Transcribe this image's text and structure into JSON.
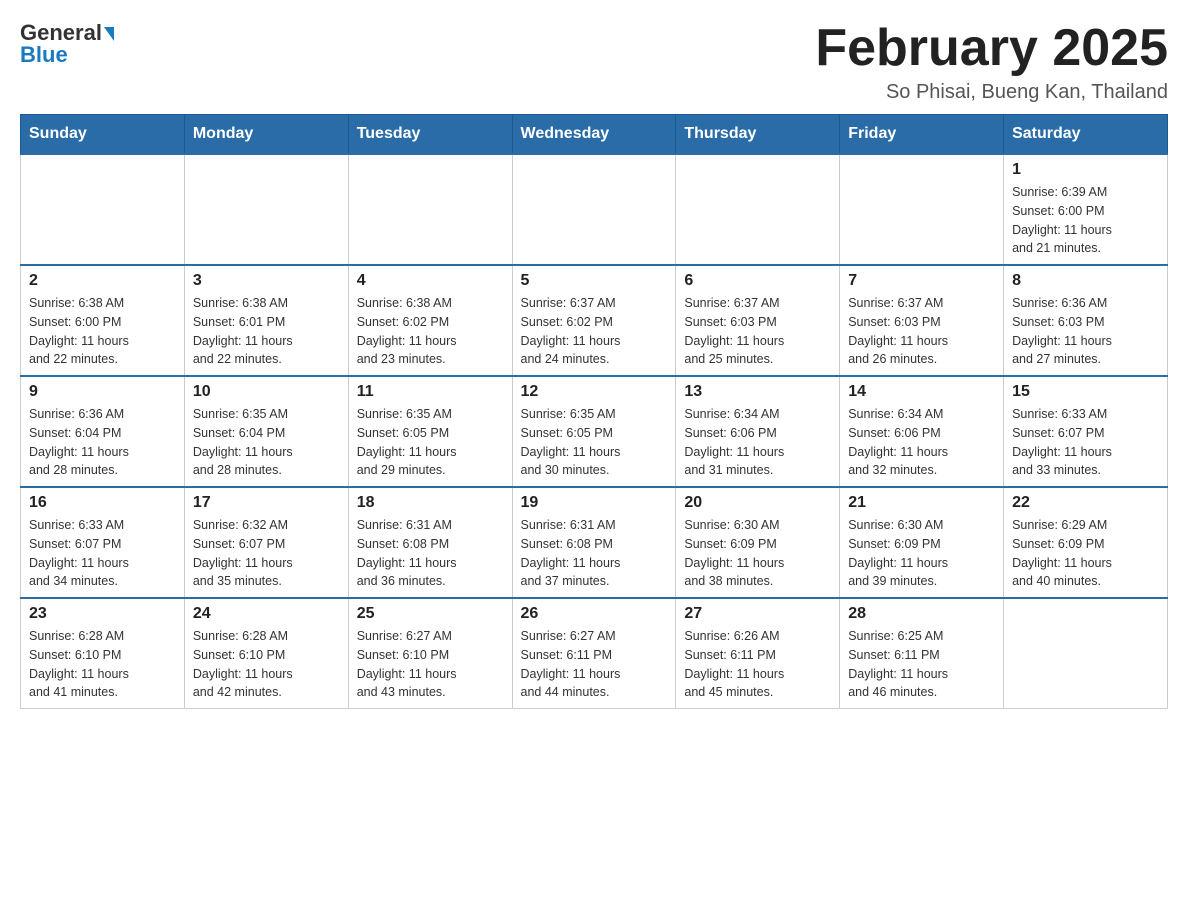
{
  "header": {
    "logo_general": "General",
    "logo_blue": "Blue",
    "month_title": "February 2025",
    "subtitle": "So Phisai, Bueng Kan, Thailand"
  },
  "weekdays": [
    "Sunday",
    "Monday",
    "Tuesday",
    "Wednesday",
    "Thursday",
    "Friday",
    "Saturday"
  ],
  "weeks": [
    [
      {
        "day": "",
        "info": ""
      },
      {
        "day": "",
        "info": ""
      },
      {
        "day": "",
        "info": ""
      },
      {
        "day": "",
        "info": ""
      },
      {
        "day": "",
        "info": ""
      },
      {
        "day": "",
        "info": ""
      },
      {
        "day": "1",
        "info": "Sunrise: 6:39 AM\nSunset: 6:00 PM\nDaylight: 11 hours\nand 21 minutes."
      }
    ],
    [
      {
        "day": "2",
        "info": "Sunrise: 6:38 AM\nSunset: 6:00 PM\nDaylight: 11 hours\nand 22 minutes."
      },
      {
        "day": "3",
        "info": "Sunrise: 6:38 AM\nSunset: 6:01 PM\nDaylight: 11 hours\nand 22 minutes."
      },
      {
        "day": "4",
        "info": "Sunrise: 6:38 AM\nSunset: 6:02 PM\nDaylight: 11 hours\nand 23 minutes."
      },
      {
        "day": "5",
        "info": "Sunrise: 6:37 AM\nSunset: 6:02 PM\nDaylight: 11 hours\nand 24 minutes."
      },
      {
        "day": "6",
        "info": "Sunrise: 6:37 AM\nSunset: 6:03 PM\nDaylight: 11 hours\nand 25 minutes."
      },
      {
        "day": "7",
        "info": "Sunrise: 6:37 AM\nSunset: 6:03 PM\nDaylight: 11 hours\nand 26 minutes."
      },
      {
        "day": "8",
        "info": "Sunrise: 6:36 AM\nSunset: 6:03 PM\nDaylight: 11 hours\nand 27 minutes."
      }
    ],
    [
      {
        "day": "9",
        "info": "Sunrise: 6:36 AM\nSunset: 6:04 PM\nDaylight: 11 hours\nand 28 minutes."
      },
      {
        "day": "10",
        "info": "Sunrise: 6:35 AM\nSunset: 6:04 PM\nDaylight: 11 hours\nand 28 minutes."
      },
      {
        "day": "11",
        "info": "Sunrise: 6:35 AM\nSunset: 6:05 PM\nDaylight: 11 hours\nand 29 minutes."
      },
      {
        "day": "12",
        "info": "Sunrise: 6:35 AM\nSunset: 6:05 PM\nDaylight: 11 hours\nand 30 minutes."
      },
      {
        "day": "13",
        "info": "Sunrise: 6:34 AM\nSunset: 6:06 PM\nDaylight: 11 hours\nand 31 minutes."
      },
      {
        "day": "14",
        "info": "Sunrise: 6:34 AM\nSunset: 6:06 PM\nDaylight: 11 hours\nand 32 minutes."
      },
      {
        "day": "15",
        "info": "Sunrise: 6:33 AM\nSunset: 6:07 PM\nDaylight: 11 hours\nand 33 minutes."
      }
    ],
    [
      {
        "day": "16",
        "info": "Sunrise: 6:33 AM\nSunset: 6:07 PM\nDaylight: 11 hours\nand 34 minutes."
      },
      {
        "day": "17",
        "info": "Sunrise: 6:32 AM\nSunset: 6:07 PM\nDaylight: 11 hours\nand 35 minutes."
      },
      {
        "day": "18",
        "info": "Sunrise: 6:31 AM\nSunset: 6:08 PM\nDaylight: 11 hours\nand 36 minutes."
      },
      {
        "day": "19",
        "info": "Sunrise: 6:31 AM\nSunset: 6:08 PM\nDaylight: 11 hours\nand 37 minutes."
      },
      {
        "day": "20",
        "info": "Sunrise: 6:30 AM\nSunset: 6:09 PM\nDaylight: 11 hours\nand 38 minutes."
      },
      {
        "day": "21",
        "info": "Sunrise: 6:30 AM\nSunset: 6:09 PM\nDaylight: 11 hours\nand 39 minutes."
      },
      {
        "day": "22",
        "info": "Sunrise: 6:29 AM\nSunset: 6:09 PM\nDaylight: 11 hours\nand 40 minutes."
      }
    ],
    [
      {
        "day": "23",
        "info": "Sunrise: 6:28 AM\nSunset: 6:10 PM\nDaylight: 11 hours\nand 41 minutes."
      },
      {
        "day": "24",
        "info": "Sunrise: 6:28 AM\nSunset: 6:10 PM\nDaylight: 11 hours\nand 42 minutes."
      },
      {
        "day": "25",
        "info": "Sunrise: 6:27 AM\nSunset: 6:10 PM\nDaylight: 11 hours\nand 43 minutes."
      },
      {
        "day": "26",
        "info": "Sunrise: 6:27 AM\nSunset: 6:11 PM\nDaylight: 11 hours\nand 44 minutes."
      },
      {
        "day": "27",
        "info": "Sunrise: 6:26 AM\nSunset: 6:11 PM\nDaylight: 11 hours\nand 45 minutes."
      },
      {
        "day": "28",
        "info": "Sunrise: 6:25 AM\nSunset: 6:11 PM\nDaylight: 11 hours\nand 46 minutes."
      },
      {
        "day": "",
        "info": ""
      }
    ]
  ]
}
